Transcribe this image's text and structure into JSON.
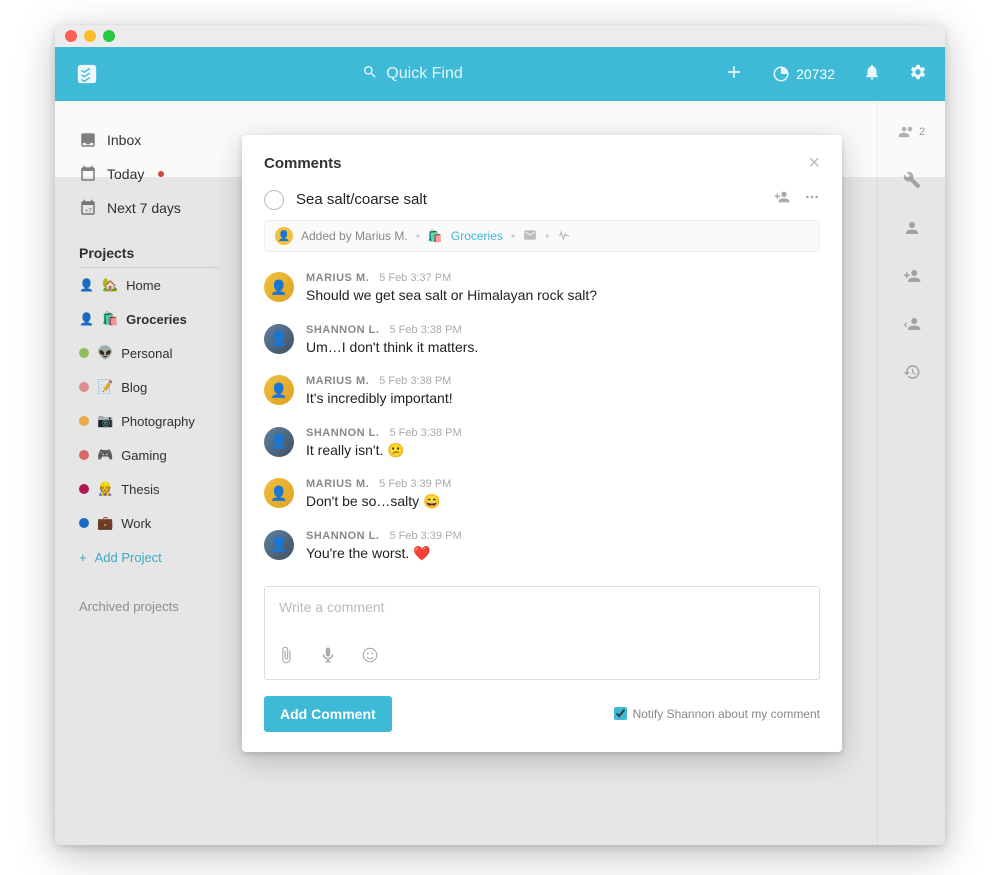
{
  "header": {
    "search_placeholder": "Quick Find",
    "karma_points": "20732"
  },
  "sidebar": {
    "items": [
      {
        "label": "Inbox"
      },
      {
        "label": "Today"
      },
      {
        "label": "Next 7 days"
      }
    ],
    "projects_header": "Projects",
    "projects": [
      {
        "emoji": "🏡",
        "label": "Home",
        "dot": "#8bc34a",
        "icon": "👤"
      },
      {
        "emoji": "🛍️",
        "label": "Groceries",
        "dot": "#e57373",
        "icon": "👤",
        "bold": true
      },
      {
        "emoji": "👽",
        "label": "Personal",
        "dot": "#9ccc65"
      },
      {
        "emoji": "📝",
        "label": "Blog",
        "dot": "#ef9a9a"
      },
      {
        "emoji": "📷",
        "label": "Photography",
        "dot": "#ffb74d"
      },
      {
        "emoji": "🎮",
        "label": "Gaming",
        "dot": "#e57373"
      },
      {
        "emoji": "👷",
        "label": "Thesis",
        "dot": "#c2185b"
      },
      {
        "emoji": "💼",
        "label": "Work",
        "dot": "#1976d2"
      }
    ],
    "add_project": "Add Project",
    "archived": "Archived projects"
  },
  "rightrail": {
    "collab_count": "2"
  },
  "modal": {
    "title": "Comments",
    "task_title": "Sea salt/coarse salt",
    "meta": {
      "added_by": "Added by Marius M.",
      "tag_emoji": "🛍️",
      "tag": "Groceries"
    },
    "comments": [
      {
        "who": "m",
        "author": "MARIUS M.",
        "time": "5 Feb 3:37 PM",
        "text": "Should we get sea salt or Himalayan rock salt?"
      },
      {
        "who": "s",
        "author": "SHANNON L.",
        "time": "5 Feb 3:38 PM",
        "text": "Um…I don't think it matters."
      },
      {
        "who": "m",
        "author": "MARIUS M.",
        "time": "5 Feb 3:38 PM",
        "text": "It's incredibly important!"
      },
      {
        "who": "s",
        "author": "SHANNON L.",
        "time": "5 Feb 3:38 PM",
        "text": "It really isn't. 😕"
      },
      {
        "who": "m",
        "author": "MARIUS M.",
        "time": "5 Feb 3:39 PM",
        "text": "Don't be so…salty 😄"
      },
      {
        "who": "s",
        "author": "SHANNON L.",
        "time": "5 Feb 3:39 PM",
        "text": "You're the worst. ❤️"
      }
    ],
    "editor_placeholder": "Write a comment",
    "add_button": "Add Comment",
    "notify_label": "Notify Shannon about my comment"
  }
}
